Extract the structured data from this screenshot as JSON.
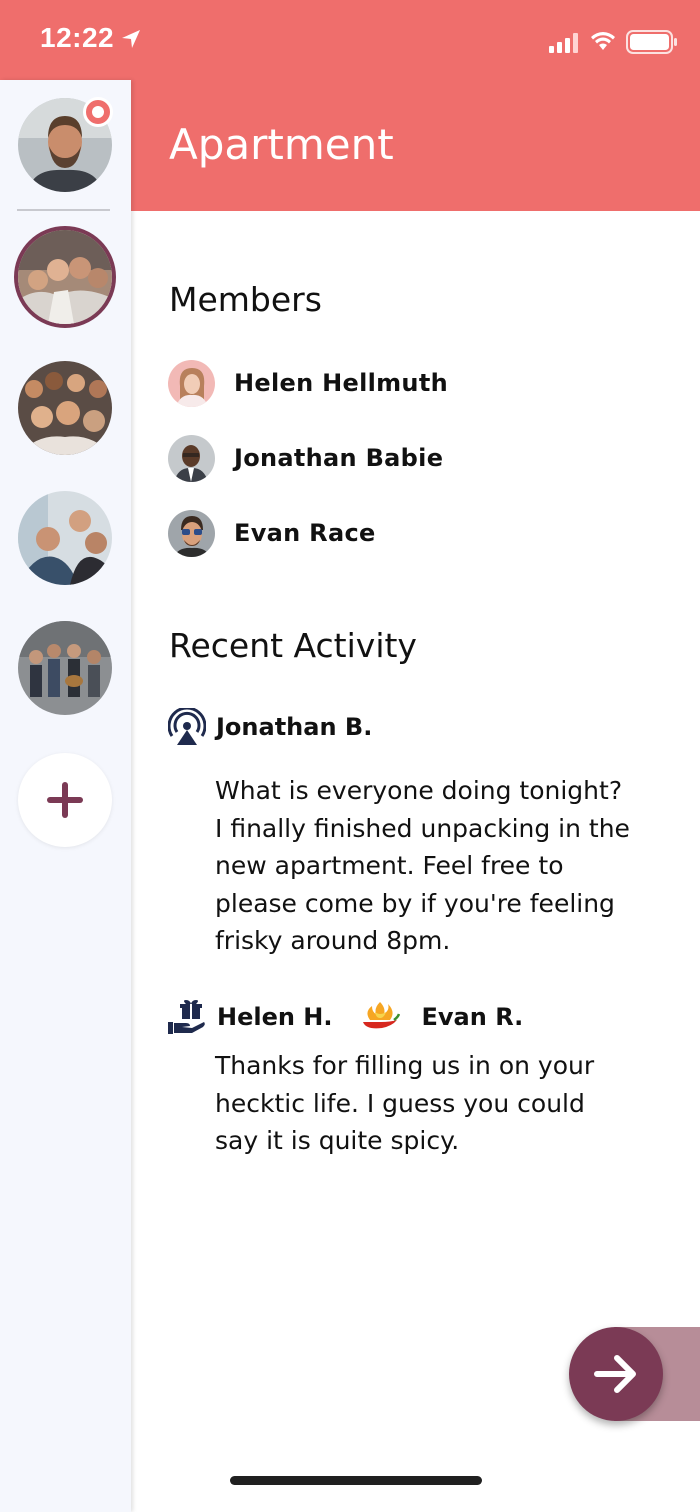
{
  "status_bar": {
    "time": "12:22"
  },
  "header": {
    "title": "Apartment"
  },
  "sidebar": {
    "groups": [
      {
        "name": "profile"
      },
      {
        "name": "group-1",
        "selected": true
      },
      {
        "name": "group-2"
      },
      {
        "name": "group-3"
      },
      {
        "name": "group-4"
      }
    ],
    "add_label": "+"
  },
  "members": {
    "title": "Members",
    "items": [
      {
        "name": "Helen Hellmuth"
      },
      {
        "name": "Jonathan Babie"
      },
      {
        "name": "Evan Race"
      }
    ]
  },
  "activity": {
    "title": "Recent Activity",
    "items": [
      {
        "icon": "podcast-icon",
        "author": "Jonathan B.",
        "text": "What is everyone doing tonight? I finally finished unpacking in the new apartment. Feel free to please come by if you're feeling frisky around 8pm."
      },
      {
        "icon": "gift-hand-icon",
        "author": "Helen H.",
        "reaction_icon": "spicy-pepper-icon",
        "reactor": "Evan R.",
        "text": "Thanks for filling us in on your hecktic life. I guess you could say it is quite spicy."
      }
    ]
  },
  "colors": {
    "accent": "#ef6e6c",
    "fab": "#7b3a55",
    "sidebar": "#f5f7fd",
    "icon_navy": "#1f2a4d"
  }
}
